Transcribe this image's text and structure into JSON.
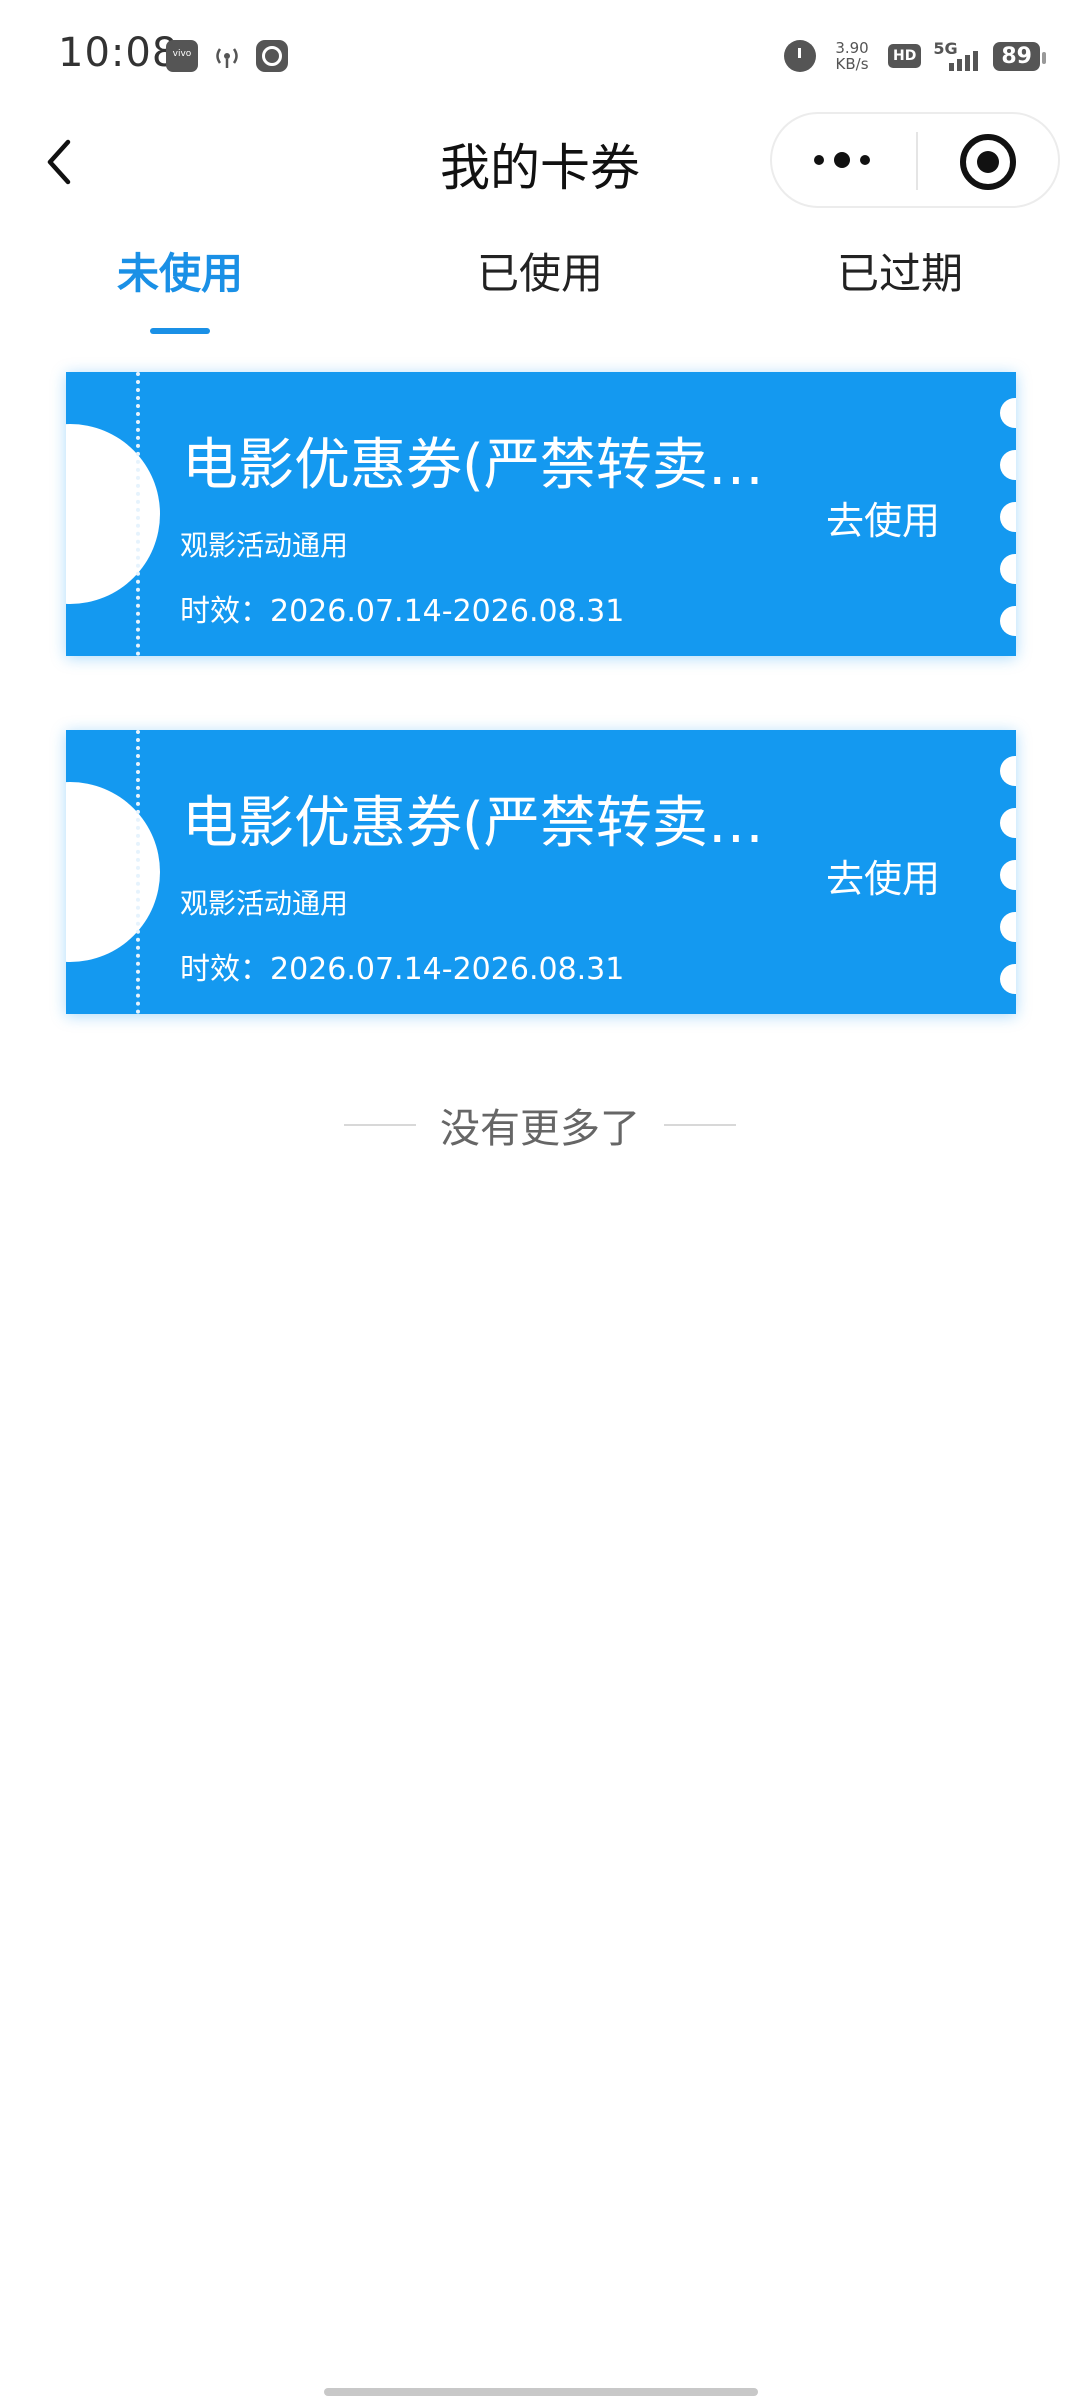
{
  "status_bar": {
    "time": "10:08",
    "net_speed_value": "3.90",
    "net_speed_unit": "KB/s",
    "hd_badge": "HD",
    "network": "5G",
    "battery": "89",
    "icons": [
      "vivo-icon",
      "hotspot-icon",
      "face-icon",
      "alarm-icon"
    ]
  },
  "nav": {
    "title": "我的卡券"
  },
  "tabs": [
    {
      "label": "未使用",
      "active": true
    },
    {
      "label": "已使用",
      "active": false
    },
    {
      "label": "已过期",
      "active": false
    }
  ],
  "coupons": [
    {
      "title": "电影优惠券(严禁转卖…",
      "subtitle": "观影活动通用",
      "validity": "时效：2026.07.14-2026.08.31",
      "action": "去使用"
    },
    {
      "title": "电影优惠券(严禁转卖…",
      "subtitle": "观影活动通用",
      "validity": "时效：2026.07.14-2026.08.31",
      "action": "去使用"
    }
  ],
  "footer": {
    "no_more_text": "没有更多了"
  },
  "colors": {
    "accent": "#1a90e6",
    "coupon_bg": "#1499f0"
  }
}
